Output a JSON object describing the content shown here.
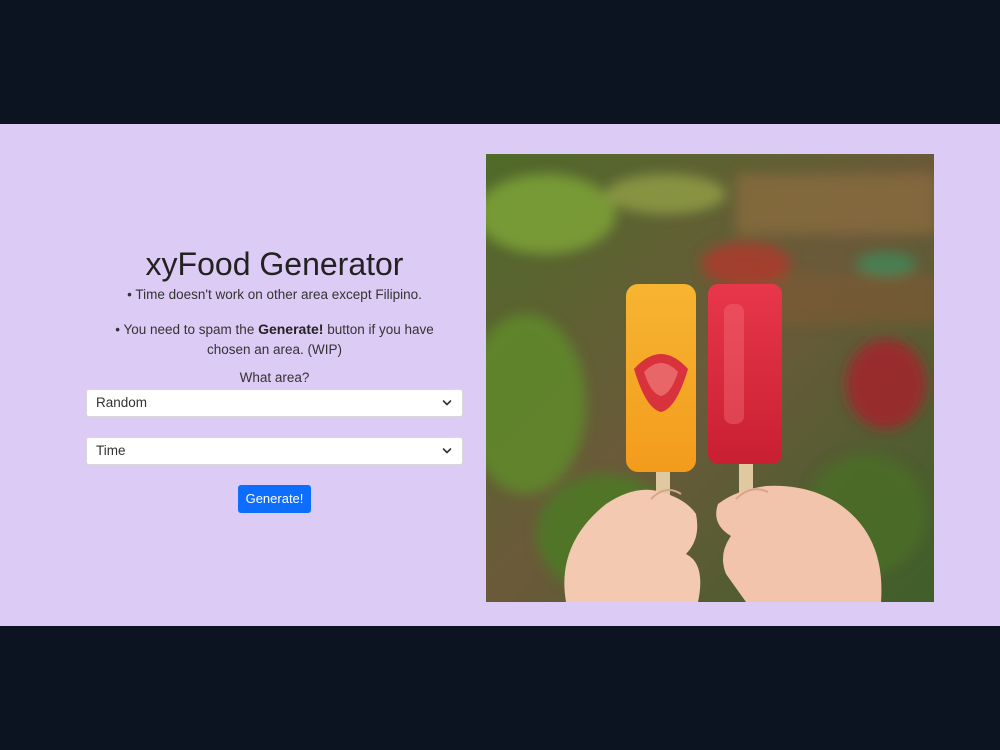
{
  "header": {
    "title": "xyFood Generator",
    "note_time": "• Time doesn't work on other area except Filipino.",
    "note_spam_prefix": "• You need to spam the ",
    "note_spam_bold": "Generate!",
    "note_spam_suffix": " button if you have chosen an area. (WIP)"
  },
  "form": {
    "area_label": "What area?",
    "area_select_value": "Random",
    "time_select_value": "Time",
    "generate_label": "Generate!"
  },
  "image": {
    "subject": "popsicles",
    "accent": "#0d6efd",
    "background": "#dccbf4"
  }
}
